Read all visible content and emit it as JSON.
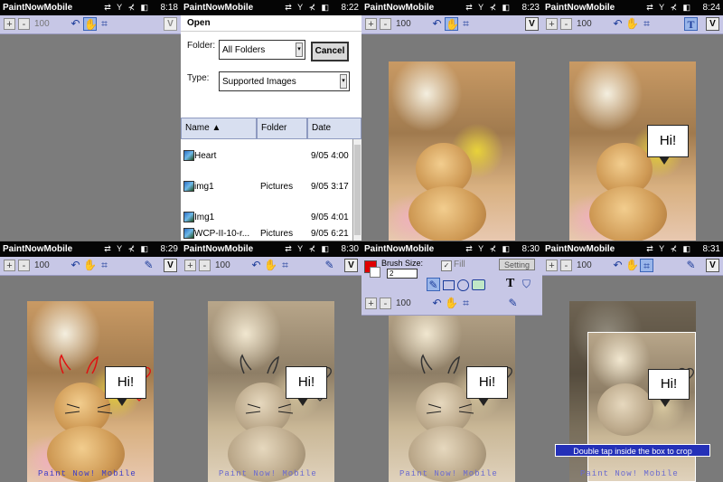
{
  "app_title": "PaintNowMobile",
  "status_icons": "⇄ Y ⊀ ◧",
  "zoom_value": "100",
  "plus_label": "+",
  "minus_label": "-",
  "v_label": "V",
  "t_label": "T",
  "watermark": "Paint Now! Mobile",
  "bubble_text": "Hi!",
  "screens": [
    {
      "time": "8:18"
    },
    {
      "time": "8:22"
    },
    {
      "time": "8:23"
    },
    {
      "time": "8:24"
    },
    {
      "time": "8:29"
    },
    {
      "time": "8:30"
    },
    {
      "time": "8:30"
    },
    {
      "time": "8:31"
    }
  ],
  "open_dialog": {
    "title": "Open",
    "folder_label": "Folder:",
    "folder_value": "All Folders",
    "cancel_label": "Cancel",
    "type_label": "Type:",
    "type_value": "Supported Images",
    "columns": [
      "Name ▲",
      "Folder",
      "Date"
    ],
    "rows": [
      {
        "name": "Heart",
        "folder": "",
        "date": "9/05 4:00"
      },
      {
        "name": "img1",
        "folder": "Pictures",
        "date": "9/05 3:17"
      },
      {
        "name": "Img1",
        "folder": "",
        "date": "9/05 4:01"
      },
      {
        "name": "WCP-II-10-r...",
        "folder": "Pictures",
        "date": "9/05 6:21"
      }
    ]
  },
  "brush_panel": {
    "brush_size_label": "Brush Size:",
    "brush_size_value": "2",
    "fill_label": "Fill",
    "fill_checked": true,
    "setting_label": "Setting",
    "color": "#e00000"
  },
  "crop_hint": "Double tap inside the box to crop",
  "colors": {
    "titlebar": "#050505",
    "toolbar": "#c7c7e6",
    "accent_blue": "#1c3c9a",
    "heart_red": "#e01010"
  }
}
